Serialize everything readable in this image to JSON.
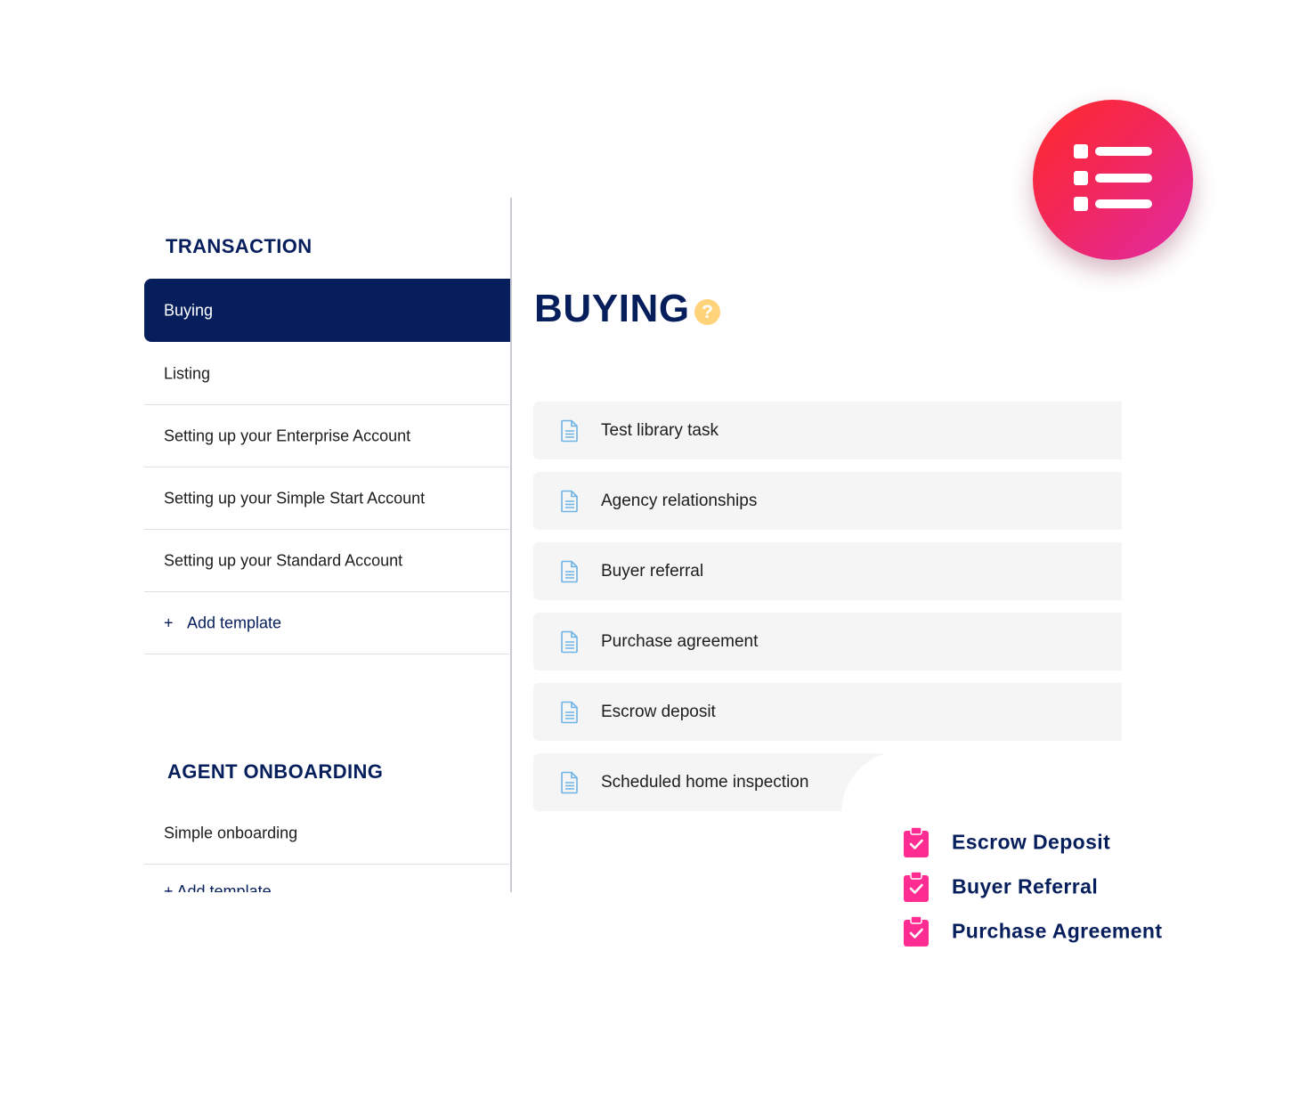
{
  "sidebar": {
    "transaction_title": "TRANSACTION",
    "transaction_items": [
      {
        "label": "Buying"
      },
      {
        "label": "Listing"
      },
      {
        "label": "Setting up your Enterprise Account"
      },
      {
        "label": "Setting up your Simple Start Account"
      },
      {
        "label": "Setting up your Standard Account"
      }
    ],
    "add_template_label": "Add template",
    "add_template_plus": "+",
    "onboarding_title": "AGENT ONBOARDING",
    "onboarding_items": [
      {
        "label": "Simple onboarding"
      }
    ],
    "onboarding_add_label": "+ Add template"
  },
  "main": {
    "title": "BUYING",
    "help_glyph": "?",
    "tasks": [
      {
        "label": "Test library task",
        "icon": "document-icon"
      },
      {
        "label": "Agency relationships",
        "icon": "document-icon"
      },
      {
        "label": "Buyer referral",
        "icon": "document-icon"
      },
      {
        "label": "Purchase agreement",
        "icon": "document-icon"
      },
      {
        "label": "Escrow deposit",
        "icon": "document-icon"
      },
      {
        "label": "Scheduled home inspection",
        "icon": "document-icon"
      }
    ]
  },
  "badge": {
    "icon": "list-icon",
    "gradient_colors": [
      "#ff2a2a",
      "#e02aa6"
    ]
  },
  "checklist": [
    {
      "label": "Escrow Deposit",
      "icon": "clipboard-check-icon"
    },
    {
      "label": "Buyer Referral",
      "icon": "clipboard-check-icon"
    },
    {
      "label": "Purchase Agreement",
      "icon": "clipboard-check-icon"
    }
  ],
  "colors": {
    "navy": "#061f5c",
    "active_bg": "#061f5c",
    "row_bg": "#f5f5f6",
    "help_yellow": "#ffd37a",
    "doc_icon_blue": "#6eb3e6",
    "check_pink": "#ff2d92"
  }
}
